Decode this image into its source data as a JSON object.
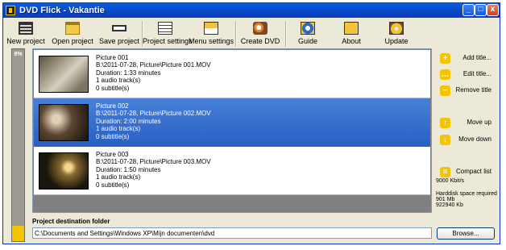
{
  "window": {
    "title": "DVD Flick - Vakantie",
    "min_glyph": "_",
    "max_glyph": "□",
    "close_glyph": "x"
  },
  "toolbar": {
    "new_project": "New project",
    "open_project": "Open project",
    "save_project": "Save project",
    "project_settings": "Project settings",
    "menu_settings": "Menu settings",
    "create_dvd": "Create DVD",
    "guide": "Guide",
    "about": "About",
    "update": "Update"
  },
  "progress": {
    "label": "8%",
    "fraction": 0.08
  },
  "titles": [
    {
      "name": "Picture 001",
      "path": "B:\\2011-07-28, Picture\\Picture 001.MOV",
      "duration": "Duration: 1:33 minutes",
      "audio": "1 audio track(s)",
      "subtitles": "0 subtitle(s)"
    },
    {
      "name": "Picture 002",
      "path": "B:\\2011-07-28, Picture\\Picture 002.MOV",
      "duration": "Duration: 2:00 minutes",
      "audio": "1 audio track(s)",
      "subtitles": "0 subtitle(s)"
    },
    {
      "name": "Picture 003",
      "path": "B:\\2011-07-28, Picture\\Picture 003.MOV",
      "duration": "Duration: 1:50 minutes",
      "audio": "1 audio track(s)",
      "subtitles": "0 subtitle(s)"
    }
  ],
  "side": {
    "add_title": "Add title...",
    "edit_title": "Edit title...",
    "remove_title": "Remove title",
    "move_up": "Move up",
    "move_down": "Move down",
    "compact_list": "Compact list",
    "bitrate": "9000 Kbit/s",
    "hd_label": "Harddisk space required",
    "hd_mb": "901 Mb",
    "hd_kb": "922940 Kb"
  },
  "destination": {
    "label": "Project destination folder",
    "path": "C:\\Documents and Settings\\Windows XP\\Mijn documenten\\dvd",
    "browse": "Browse..."
  },
  "colors": {
    "accent": "#f5c400",
    "selection": "#316ac5",
    "titlebar": "#0a5fe0"
  }
}
